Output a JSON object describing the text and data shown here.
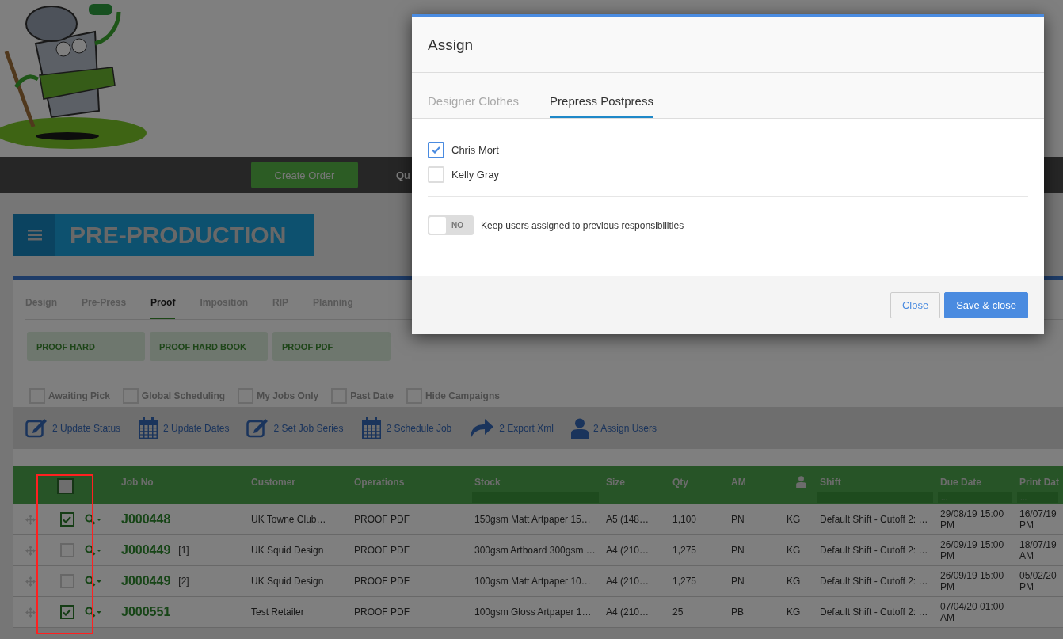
{
  "nav": {
    "buttons": [
      {
        "label": "Create Order",
        "kind": "primary"
      },
      {
        "label": "Qu",
        "kind": "link"
      }
    ]
  },
  "page_title": "PRE-PRODUCTION",
  "stage_tabs": [
    {
      "label": "Design",
      "selected": false
    },
    {
      "label": "Pre-Press",
      "selected": false
    },
    {
      "label": "Proof",
      "selected": true
    },
    {
      "label": "Imposition",
      "selected": false
    },
    {
      "label": "RIP",
      "selected": false
    },
    {
      "label": "Planning",
      "selected": false
    }
  ],
  "categories": [
    "PROOF HARD",
    "PROOF HARD BOOK",
    "PROOF PDF"
  ],
  "filters": [
    {
      "label": "Awaiting Pick",
      "checked": false
    },
    {
      "label": "Global Scheduling",
      "checked": false
    },
    {
      "label": "My Jobs Only",
      "checked": false
    },
    {
      "label": "Past Date",
      "checked": false
    },
    {
      "label": "Hide Campaigns",
      "checked": false
    }
  ],
  "actions": [
    {
      "label": "2 Update Status",
      "kind": "edit"
    },
    {
      "label": "2 Update Dates",
      "kind": "calendar"
    },
    {
      "label": "2 Set Job Series",
      "kind": "edit"
    },
    {
      "label": "2 Schedule Job",
      "kind": "calendar"
    },
    {
      "label": "2 Export Xml",
      "kind": "share"
    },
    {
      "label": "2 Assign Users",
      "kind": "user"
    }
  ],
  "table": {
    "select_all": {
      "checked": false
    },
    "job_column": {
      "label": "Job No"
    },
    "columns": [
      {
        "kind": "text",
        "label": "Customer"
      },
      {
        "kind": "text",
        "label": "Operations"
      },
      {
        "kind": "text",
        "label": "Stock",
        "filter": true
      },
      {
        "kind": "text",
        "label": "Size"
      },
      {
        "kind": "text",
        "label": "Qty"
      },
      {
        "kind": "text",
        "label": "AM"
      },
      {
        "kind": "user"
      },
      {
        "kind": "text",
        "label": "Shift",
        "filter": true
      },
      {
        "kind": "text",
        "label": "Due Date",
        "filter": true,
        "placeholder": "..."
      },
      {
        "kind": "text",
        "label": "Print Dat",
        "filter": true,
        "placeholder": "..."
      }
    ],
    "rows": [
      {
        "checked": true,
        "job_no": "J000448",
        "cells": [
          "UK Towne Club…",
          "PROOF PDF",
          "150gsm Matt Artpaper 15…",
          "A5 (148…",
          "1,100",
          "PN",
          "KG",
          "Default Shift - Cutoff 2: …",
          "29/08/19 15:00 PM",
          "16/07/19 PM"
        ]
      },
      {
        "checked": false,
        "job_no": "J000449",
        "part": "[1]",
        "cells": [
          "UK Squid Design",
          "PROOF PDF",
          "300gsm Artboard 300gsm …",
          "A4 (210…",
          "1,275",
          "PN",
          "KG",
          "Default Shift - Cutoff 2: …",
          "26/09/19 15:00 PM",
          "18/07/19 AM"
        ]
      },
      {
        "checked": false,
        "job_no": "J000449",
        "part": "[2]",
        "cells": [
          "UK Squid Design",
          "PROOF PDF",
          "100gsm Matt Artpaper 10…",
          "A4 (210…",
          "1,275",
          "PN",
          "KG",
          "Default Shift - Cutoff 2: …",
          "26/09/19 15:00 PM",
          "05/02/20 PM"
        ]
      },
      {
        "checked": true,
        "job_no": "J000551",
        "cells": [
          "Test Retailer",
          "PROOF PDF",
          "100gsm Gloss Artpaper 1…",
          "A4 (210…",
          "25",
          "PB",
          "KG",
          "Default Shift - Cutoff 2: …",
          "07/04/20 01:00 AM"
        ]
      }
    ]
  },
  "modal": {
    "title": "Assign",
    "tabs": [
      {
        "label": "Designer Clothes",
        "selected": false
      },
      {
        "label": "Prepress Postpress",
        "selected": true
      }
    ],
    "users": [
      {
        "name": "Chris Mort",
        "checked": true
      },
      {
        "name": "Kelly Gray",
        "checked": false
      }
    ],
    "toggle": {
      "label": "NO",
      "on": false,
      "text": "Keep users assigned to previous responsibilities"
    },
    "buttons": [
      {
        "label": "Close",
        "kind": "secondary"
      },
      {
        "label": "Save & close",
        "kind": "primary"
      }
    ]
  }
}
